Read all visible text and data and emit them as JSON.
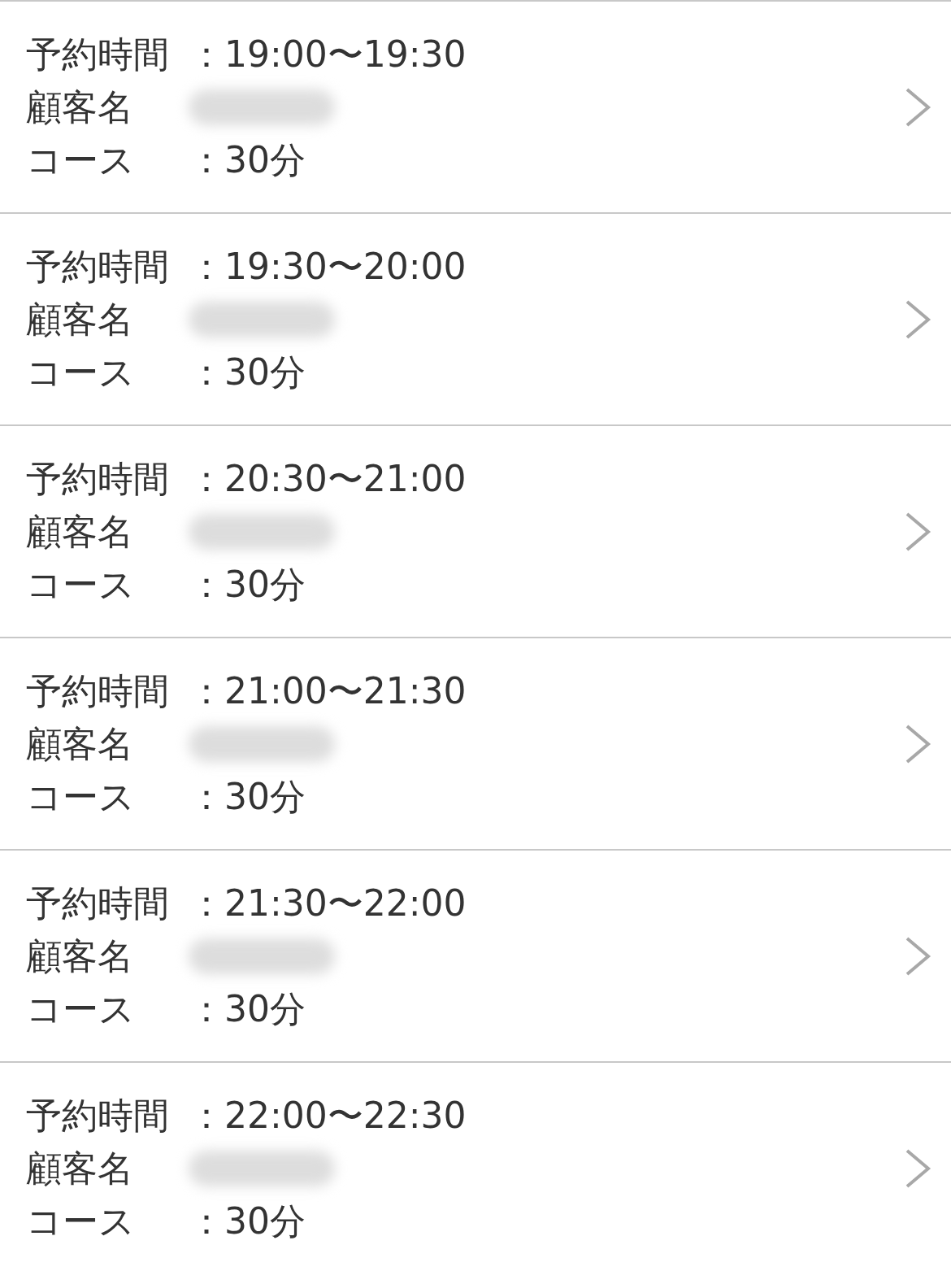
{
  "reservations": [
    {
      "time_label": "予約時間",
      "time_value": "：19:00〜19:30",
      "name_label": "顧客名",
      "course_label": "コース",
      "course_value": "：30分"
    },
    {
      "time_label": "予約時間",
      "time_value": "：19:30〜20:00",
      "name_label": "顧客名",
      "course_label": "コース",
      "course_value": "：30分"
    },
    {
      "time_label": "予約時間",
      "time_value": "：20:30〜21:00",
      "name_label": "顧客名",
      "course_label": "コース",
      "course_value": "：30分"
    },
    {
      "time_label": "予約時間",
      "time_value": "：21:00〜21:30",
      "name_label": "顧客名",
      "course_label": "コース",
      "course_value": "：30分"
    },
    {
      "time_label": "予約時間",
      "time_value": "：21:30〜22:00",
      "name_label": "顧客名",
      "course_label": "コース",
      "course_value": "：30分"
    },
    {
      "time_label": "予約時間",
      "time_value": "：22:00〜22:30",
      "name_label": "顧客名",
      "course_label": "コース",
      "course_value": "：30分"
    }
  ]
}
